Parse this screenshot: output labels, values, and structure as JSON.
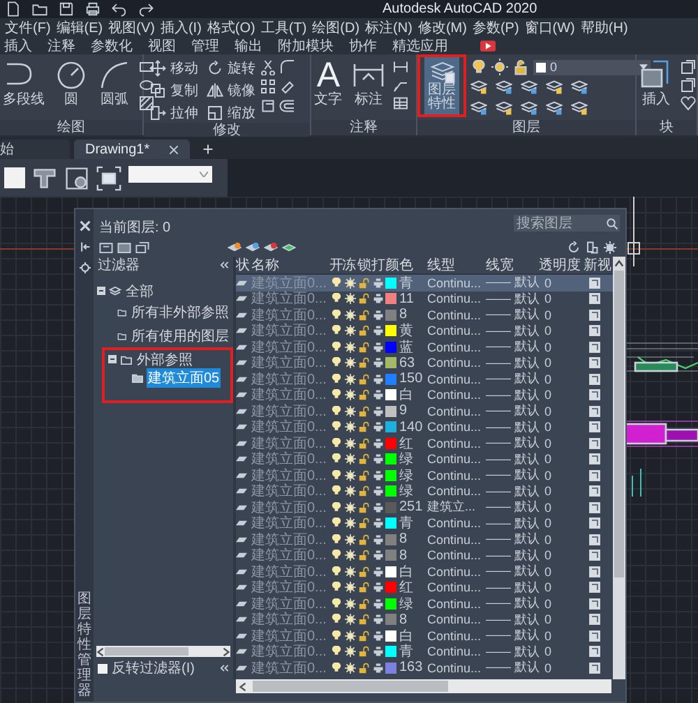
{
  "title_bar": {
    "title": "Autodesk AutoCAD 2020"
  },
  "menu": [
    "文件(F)",
    "编辑(E)",
    "视图(V)",
    "插入(I)",
    "格式(O)",
    "工具(T)",
    "绘图(D)",
    "标注(N)",
    "修改(M)",
    "参数(P)",
    "窗口(W)",
    "帮助(H)"
  ],
  "ribbon_tabs": [
    "插入",
    "注释",
    "参数化",
    "视图",
    "管理",
    "输出",
    "附加模块",
    "协作",
    "精选应用"
  ],
  "ribbon": {
    "draw": {
      "title": "绘图",
      "buttons": [
        "多段线",
        "圆",
        "圆弧"
      ]
    },
    "modify": {
      "title": "修改",
      "buttons": [
        "移动",
        "旋转",
        "复制",
        "镜像",
        "拉伸",
        "缩放"
      ]
    },
    "annotate": {
      "title": "注释",
      "text_glyph": "A",
      "buttons": [
        "文字",
        "标注"
      ]
    },
    "layers": {
      "title": "图层",
      "properties_button": {
        "label": "图层特性",
        "highlighted": true
      },
      "current_layer": "0"
    },
    "block": {
      "title": "块",
      "buttons": [
        "插入"
      ]
    }
  },
  "doc_tabs": [
    {
      "label": "始",
      "selected": false
    },
    {
      "label": "Drawing1*",
      "selected": true
    }
  ],
  "layer_palette": {
    "side_title": "图层特性管理器",
    "current_layer": "当前图层: 0",
    "search": {
      "placeholder": "搜索图层"
    },
    "filter_title": "过滤器",
    "filters": [
      {
        "label": "全部",
        "expanded": true,
        "selected": false,
        "children": [
          {
            "label": "所有非外部参照",
            "selected": false,
            "highlighted": false
          },
          {
            "label": "所有使用的图层",
            "selected": false,
            "highlighted": false
          },
          {
            "label": "外部参照",
            "expanded": true,
            "selected": false,
            "highlighted": true,
            "children": [
              {
                "label": "建筑立面05",
                "selected": true
              }
            ]
          }
        ]
      }
    ],
    "invert_filter": {
      "label": "反转过滤器(I)",
      "checked": false
    },
    "columns": [
      "状",
      "名称",
      "开",
      "冻",
      "锁",
      "打",
      "颜色",
      "线型",
      "线宽",
      "透明度",
      "新视"
    ],
    "rows": [
      {
        "name": "建筑立面0...",
        "on": true,
        "frozen": false,
        "locked": false,
        "color": "#00ffff",
        "color_name": "青",
        "linetype": "Continu...",
        "lineweight": "—— 默认",
        "transparency": "0",
        "selected": true
      },
      {
        "name": "建筑立面0...",
        "on": true,
        "frozen": false,
        "locked": false,
        "color": "#f08080",
        "color_name": "11",
        "linetype": "Continu...",
        "lineweight": "—— 默认",
        "transparency": "0",
        "selected": false
      },
      {
        "name": "建筑立面0...",
        "on": true,
        "frozen": false,
        "locked": false,
        "color": "#808080",
        "color_name": "8",
        "linetype": "Continu...",
        "lineweight": "—— 默认",
        "transparency": "0",
        "selected": false
      },
      {
        "name": "建筑立面0...",
        "on": true,
        "frozen": false,
        "locked": false,
        "color": "#ffff00",
        "color_name": "黄",
        "linetype": "Continu...",
        "lineweight": "—— 默认",
        "transparency": "0",
        "selected": false
      },
      {
        "name": "建筑立面0...",
        "on": true,
        "frozen": false,
        "locked": false,
        "color": "#0000ff",
        "color_name": "蓝",
        "linetype": "Continu...",
        "lineweight": "—— 默认",
        "transparency": "0",
        "selected": false
      },
      {
        "name": "建筑立面0...",
        "on": true,
        "frozen": false,
        "locked": false,
        "color": "#a5b86a",
        "color_name": "63",
        "linetype": "Continu...",
        "lineweight": "—— 默认",
        "transparency": "0",
        "selected": false
      },
      {
        "name": "建筑立面0...",
        "on": true,
        "frozen": false,
        "locked": false,
        "color": "#1f7fff",
        "color_name": "150",
        "linetype": "Continu...",
        "lineweight": "—— 默认",
        "transparency": "0",
        "selected": false
      },
      {
        "name": "建筑立面0...",
        "on": true,
        "frozen": false,
        "locked": false,
        "color": "#ffffff",
        "color_name": "白",
        "linetype": "Continu...",
        "lineweight": "—— 默认",
        "transparency": "0",
        "selected": false
      },
      {
        "name": "建筑立面0...",
        "on": true,
        "frozen": false,
        "locked": false,
        "color": "#c0c0c0",
        "color_name": "9",
        "linetype": "Continu...",
        "lineweight": "—— 默认",
        "transparency": "0",
        "selected": false
      },
      {
        "name": "建筑立面0...",
        "on": true,
        "frozen": false,
        "locked": false,
        "color": "#1fafdf",
        "color_name": "140",
        "linetype": "Continu...",
        "lineweight": "—— 默认",
        "transparency": "0",
        "selected": false
      },
      {
        "name": "建筑立面0...",
        "on": true,
        "frozen": false,
        "locked": false,
        "color": "#ff0000",
        "color_name": "红",
        "linetype": "Continu...",
        "lineweight": "—— 默认",
        "transparency": "0",
        "selected": false
      },
      {
        "name": "建筑立面0...",
        "on": true,
        "frozen": false,
        "locked": false,
        "color": "#00ff00",
        "color_name": "绿",
        "linetype": "Continu...",
        "lineweight": "—— 默认",
        "transparency": "0",
        "selected": false
      },
      {
        "name": "建筑立面0...",
        "on": true,
        "frozen": false,
        "locked": false,
        "color": "#00ff00",
        "color_name": "绿",
        "linetype": "Continu...",
        "lineweight": "—— 默认",
        "transparency": "0",
        "selected": false
      },
      {
        "name": "建筑立面0...",
        "on": true,
        "frozen": false,
        "locked": false,
        "color": "#00ff00",
        "color_name": "绿",
        "linetype": "Continu...",
        "lineweight": "—— 默认",
        "transparency": "0",
        "selected": false
      },
      {
        "name": "建筑立面0...",
        "on": true,
        "frozen": false,
        "locked": false,
        "color": "#5a5a5a",
        "color_name": "251",
        "linetype": "建筑立...",
        "lineweight": "—— 默认",
        "transparency": "0",
        "selected": false
      },
      {
        "name": "建筑立面0...",
        "on": true,
        "frozen": false,
        "locked": false,
        "color": "#00ffff",
        "color_name": "青",
        "linetype": "Continu...",
        "lineweight": "—— 默认",
        "transparency": "0",
        "selected": false
      },
      {
        "name": "建筑立面0...",
        "on": true,
        "frozen": false,
        "locked": false,
        "color": "#808080",
        "color_name": "8",
        "linetype": "Continu...",
        "lineweight": "—— 默认",
        "transparency": "0",
        "selected": false
      },
      {
        "name": "建筑立面0...",
        "on": true,
        "frozen": false,
        "locked": false,
        "color": "#808080",
        "color_name": "8",
        "linetype": "Continu...",
        "lineweight": "—— 默认",
        "transparency": "0",
        "selected": false
      },
      {
        "name": "建筑立面0...",
        "on": true,
        "frozen": false,
        "locked": false,
        "color": "#ffffff",
        "color_name": "白",
        "linetype": "Continu...",
        "lineweight": "—— 默认",
        "transparency": "0",
        "selected": false
      },
      {
        "name": "建筑立面0...",
        "on": true,
        "frozen": false,
        "locked": false,
        "color": "#ff0000",
        "color_name": "红",
        "linetype": "Continu...",
        "lineweight": "—— 默认",
        "transparency": "0",
        "selected": false
      },
      {
        "name": "建筑立面0...",
        "on": true,
        "frozen": false,
        "locked": false,
        "color": "#00ff00",
        "color_name": "绿",
        "linetype": "Continu...",
        "lineweight": "—— 默认",
        "transparency": "0",
        "selected": false
      },
      {
        "name": "建筑立面0...",
        "on": true,
        "frozen": false,
        "locked": false,
        "color": "#808080",
        "color_name": "8",
        "linetype": "Continu...",
        "lineweight": "—— 默认",
        "transparency": "0",
        "selected": false
      },
      {
        "name": "建筑立面0...",
        "on": true,
        "frozen": false,
        "locked": false,
        "color": "#ffffff",
        "color_name": "白",
        "linetype": "Continu...",
        "lineweight": "—— 默认",
        "transparency": "0",
        "selected": false
      },
      {
        "name": "建筑立面0...",
        "on": true,
        "frozen": false,
        "locked": false,
        "color": "#00ffff",
        "color_name": "青",
        "linetype": "Continu...",
        "lineweight": "—— 默认",
        "transparency": "0",
        "selected": false
      },
      {
        "name": "建筑立面0...",
        "on": true,
        "frozen": false,
        "locked": false,
        "color": "#7f7fdf",
        "color_name": "163",
        "linetype": "Continu...",
        "lineweight": "—— 默认",
        "transparency": "0",
        "selected": false
      }
    ]
  }
}
